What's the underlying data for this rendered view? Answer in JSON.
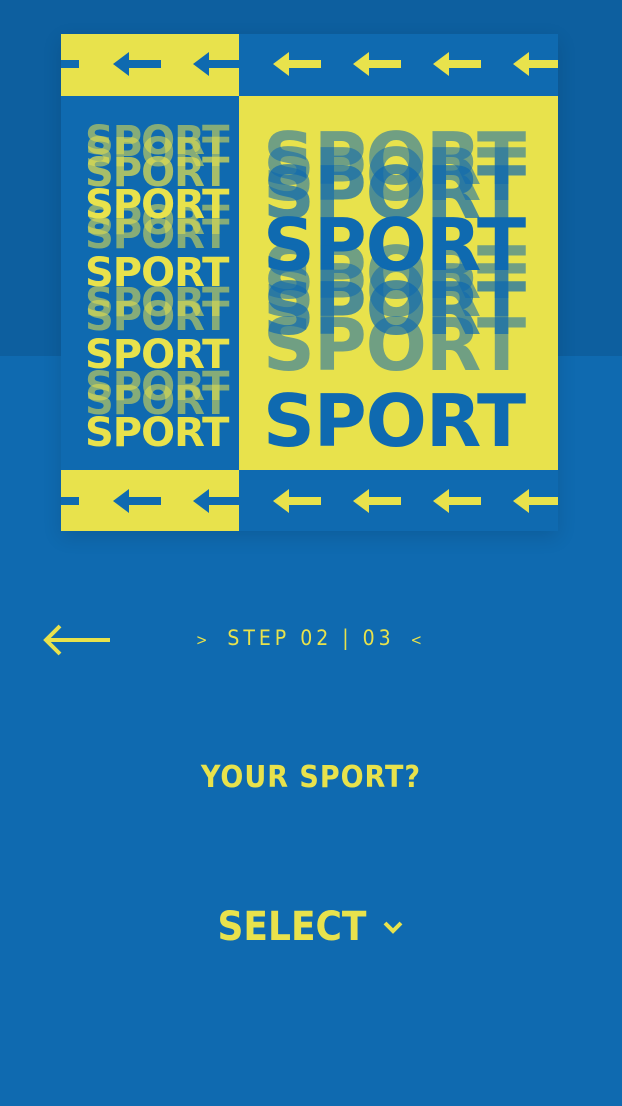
{
  "poster": {
    "colors": {
      "yellow": "#e8e24c",
      "blue": "#0f6ab0"
    },
    "word": "SPORT",
    "arrow_icon": "arrow-left-icon"
  },
  "navigation": {
    "back_icon": "arrow-left-icon",
    "step_prefix": ">",
    "step_text": "STEP 02 | 03",
    "step_suffix": "<"
  },
  "question": {
    "text": "YOUR SPORT?"
  },
  "select": {
    "label": "SELECT",
    "icon": "chevron-down-icon"
  }
}
